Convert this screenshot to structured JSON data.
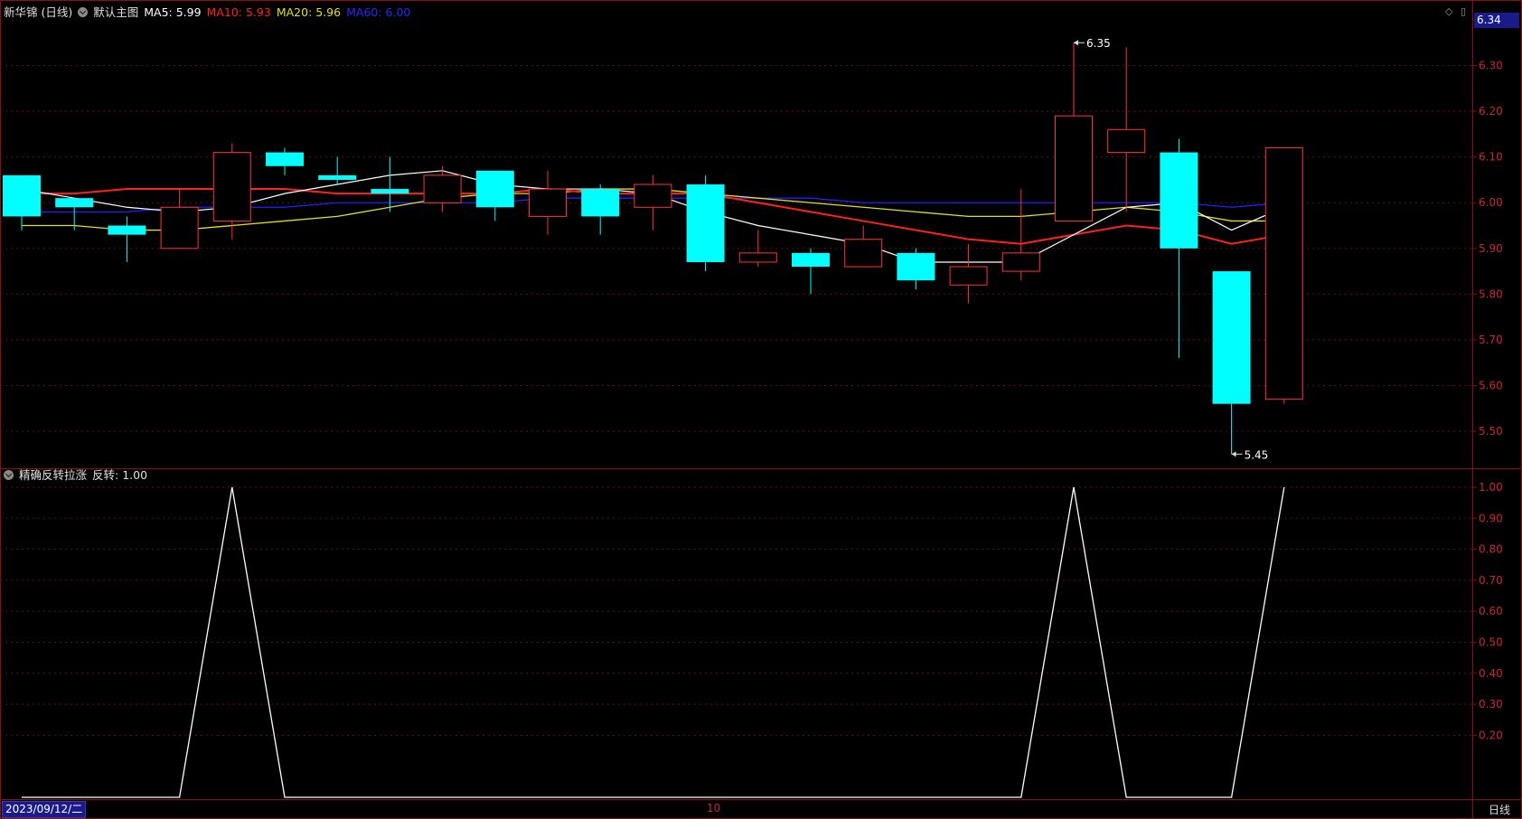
{
  "main_header": {
    "stock": "新华锦 (日线)",
    "template": "默认主图",
    "ma5": "MA5: 5.99",
    "ma10": "MA10: 5.93",
    "ma20": "MA20: 5.96",
    "ma60": "MA60: 6.00"
  },
  "sub_header": {
    "indicator": "精确反转拉涨",
    "value": "反转: 1.00"
  },
  "current_price_tag": "6.34",
  "date_label": "2023/09/12/二",
  "month_tick": "10",
  "period_button": "日线",
  "colors": {
    "up": "#ff3232",
    "down": "#00ffff",
    "ma5": "#ffffff",
    "ma10": "#ff2020",
    "ma20": "#e0e020",
    "ma60": "#2020ff",
    "grid": "#6a0f0f",
    "axis_text": "#c8282e"
  },
  "chart_data": [
    {
      "type": "candlestick",
      "title": "新华锦 (日线)",
      "ylim": [
        5.4,
        6.4
      ],
      "yticks": [
        "6.30",
        "6.20",
        "6.10",
        "6.00",
        "5.90",
        "5.80",
        "5.70",
        "5.60",
        "5.50"
      ],
      "candles": [
        {
          "o": 6.06,
          "h": 6.06,
          "l": 5.94,
          "c": 5.97
        },
        {
          "o": 6.01,
          "h": 6.01,
          "l": 5.94,
          "c": 5.99
        },
        {
          "o": 5.95,
          "h": 5.97,
          "l": 5.87,
          "c": 5.93
        },
        {
          "o": 5.9,
          "h": 6.03,
          "l": 5.9,
          "c": 5.99
        },
        {
          "o": 5.96,
          "h": 6.13,
          "l": 5.92,
          "c": 6.11
        },
        {
          "o": 6.11,
          "h": 6.12,
          "l": 6.06,
          "c": 6.08
        },
        {
          "o": 6.06,
          "h": 6.1,
          "l": 6.04,
          "c": 6.05
        },
        {
          "o": 6.03,
          "h": 6.1,
          "l": 5.98,
          "c": 6.02
        },
        {
          "o": 6.0,
          "h": 6.08,
          "l": 5.98,
          "c": 6.06
        },
        {
          "o": 6.07,
          "h": 6.07,
          "l": 5.96,
          "c": 5.99
        },
        {
          "o": 5.97,
          "h": 6.07,
          "l": 5.93,
          "c": 6.03
        },
        {
          "o": 6.03,
          "h": 6.04,
          "l": 5.93,
          "c": 5.97
        },
        {
          "o": 5.99,
          "h": 6.06,
          "l": 5.94,
          "c": 6.04
        },
        {
          "o": 6.04,
          "h": 6.06,
          "l": 5.85,
          "c": 5.87
        },
        {
          "o": 5.87,
          "h": 5.94,
          "l": 5.86,
          "c": 5.89
        },
        {
          "o": 5.89,
          "h": 5.9,
          "l": 5.8,
          "c": 5.86
        },
        {
          "o": 5.86,
          "h": 5.95,
          "l": 5.86,
          "c": 5.92
        },
        {
          "o": 5.89,
          "h": 5.9,
          "l": 5.81,
          "c": 5.83
        },
        {
          "o": 5.82,
          "h": 5.91,
          "l": 5.78,
          "c": 5.86
        },
        {
          "o": 5.85,
          "h": 6.03,
          "l": 5.83,
          "c": 5.89
        },
        {
          "o": 5.96,
          "h": 6.35,
          "l": 5.96,
          "c": 6.19
        },
        {
          "o": 6.11,
          "h": 6.34,
          "l": 5.98,
          "c": 6.16
        },
        {
          "o": 6.11,
          "h": 6.14,
          "l": 5.66,
          "c": 5.9
        },
        {
          "o": 5.85,
          "h": 5.85,
          "l": 5.45,
          "c": 5.56
        },
        {
          "o": 5.57,
          "h": 6.12,
          "l": 5.56,
          "c": 6.12
        }
      ],
      "ma5": [
        6.03,
        6.01,
        5.99,
        5.98,
        5.99,
        6.02,
        6.04,
        6.06,
        6.07,
        6.04,
        6.03,
        6.03,
        6.02,
        5.98,
        5.95,
        5.93,
        5.91,
        5.87,
        5.87,
        5.87,
        5.93,
        5.99,
        6.0,
        5.94,
        5.99
      ],
      "ma10": [
        6.02,
        6.02,
        6.03,
        6.03,
        6.03,
        6.03,
        6.02,
        6.02,
        6.02,
        6.02,
        6.03,
        6.02,
        6.02,
        6.02,
        6.0,
        5.98,
        5.96,
        5.94,
        5.92,
        5.91,
        5.93,
        5.95,
        5.94,
        5.91,
        5.93
      ],
      "ma20": [
        5.95,
        5.95,
        5.94,
        5.94,
        5.95,
        5.96,
        5.97,
        5.99,
        6.01,
        6.02,
        6.02,
        6.03,
        6.03,
        6.02,
        6.01,
        6.0,
        5.99,
        5.98,
        5.97,
        5.97,
        5.98,
        5.99,
        5.98,
        5.96,
        5.96
      ],
      "ma60": [
        5.98,
        5.98,
        5.98,
        5.99,
        5.99,
        5.99,
        6.0,
        6.0,
        6.0,
        6.0,
        6.01,
        6.01,
        6.01,
        6.01,
        6.01,
        6.01,
        6.0,
        6.0,
        6.0,
        6.0,
        6.0,
        6.0,
        6.0,
        5.99,
        6.0
      ],
      "annotations": [
        {
          "label": "6.35",
          "candle_index": 20,
          "value": 6.35
        },
        {
          "label": "5.45",
          "candle_index": 23,
          "value": 5.45
        }
      ]
    },
    {
      "type": "line",
      "title": "精确反转拉涨",
      "ylim": [
        0,
        1.0
      ],
      "yticks": [
        "1.00",
        "0.90",
        "0.80",
        "0.70",
        "0.60",
        "0.50",
        "0.40",
        "0.30",
        "0.20"
      ],
      "series": [
        {
          "name": "反转",
          "values": [
            0,
            0,
            0,
            0,
            1,
            0,
            0,
            0,
            0,
            0,
            0,
            0,
            0,
            0,
            0,
            0,
            0,
            0,
            0,
            0,
            1,
            0,
            0,
            0,
            1
          ]
        }
      ]
    }
  ]
}
